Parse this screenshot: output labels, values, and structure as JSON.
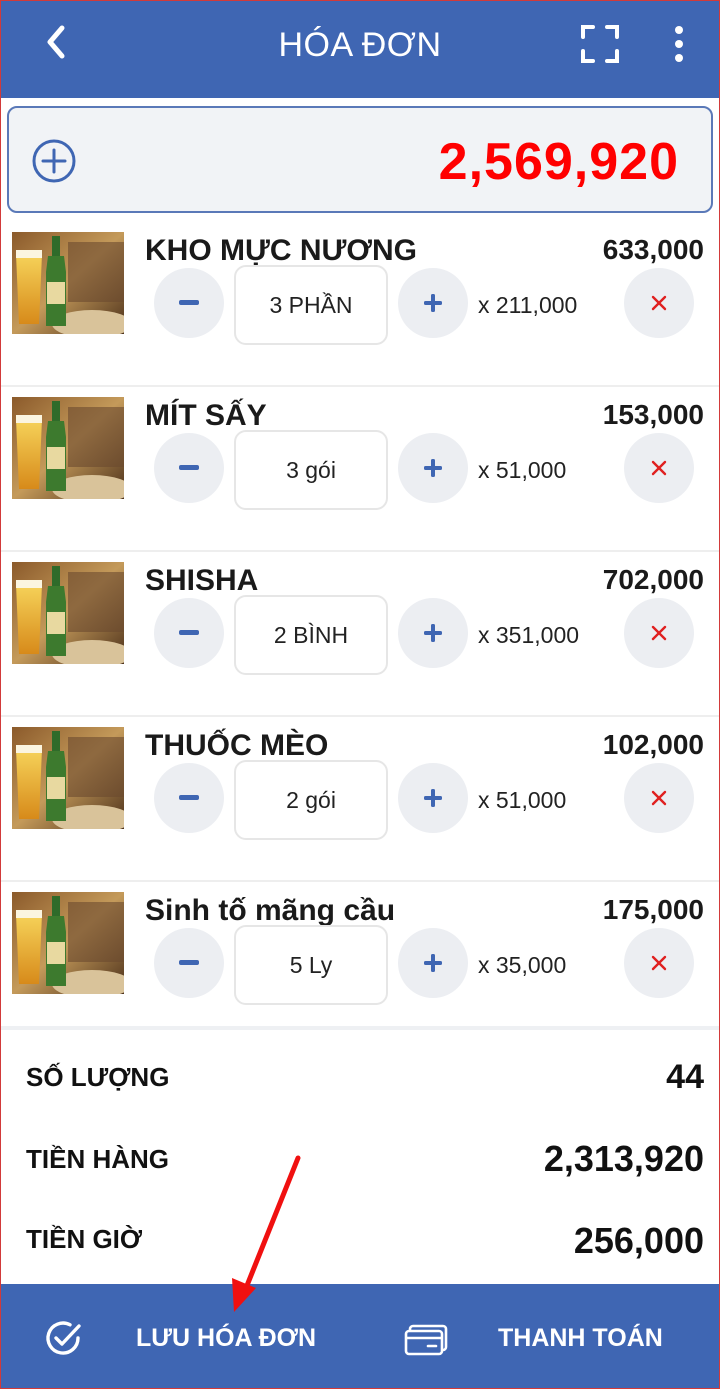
{
  "header": {
    "title": "HÓA ĐƠN",
    "back_icon": "chevron-left-icon",
    "scan_icon": "fullscreen-icon",
    "more_icon": "more-vertical-icon"
  },
  "total_bar": {
    "add_icon": "plus-circle-icon",
    "total": "2,569,920",
    "total_color": "#ff0000"
  },
  "items": [
    {
      "name": "KHO MỰC NƯƠNG",
      "line_total": "633,000",
      "quantity": "3 PHẦN",
      "unit_price": "x 211,000"
    },
    {
      "name": "MÍT SẤY",
      "line_total": "153,000",
      "quantity": "3 gói",
      "unit_price": "x 51,000"
    },
    {
      "name": "SHISHA",
      "line_total": "702,000",
      "quantity": "2 BÌNH",
      "unit_price": "x 351,000"
    },
    {
      "name": "THUỐC MÈO",
      "line_total": "102,000",
      "quantity": "2 gói",
      "unit_price": "x 51,000"
    },
    {
      "name": "Sinh tố mãng cầu",
      "line_total": "175,000",
      "quantity": "5 Ly",
      "unit_price": "x 35,000"
    }
  ],
  "summary": {
    "qty_label": "SỐ LƯỢNG",
    "qty_value": "44",
    "goods_label": "TIỀN HÀNG",
    "goods_value": "2,313,920",
    "time_label": "TIỀN GIỜ",
    "time_value": "256,000"
  },
  "bottom_bar": {
    "save_label": "LƯU HÓA ĐƠN",
    "pay_label": "THANH TOÁN",
    "save_icon": "check-circle-icon",
    "pay_icon": "credit-card-icon"
  },
  "colors": {
    "primary": "#3f66b3",
    "danger": "#e02020",
    "annotation": "#f01010"
  }
}
